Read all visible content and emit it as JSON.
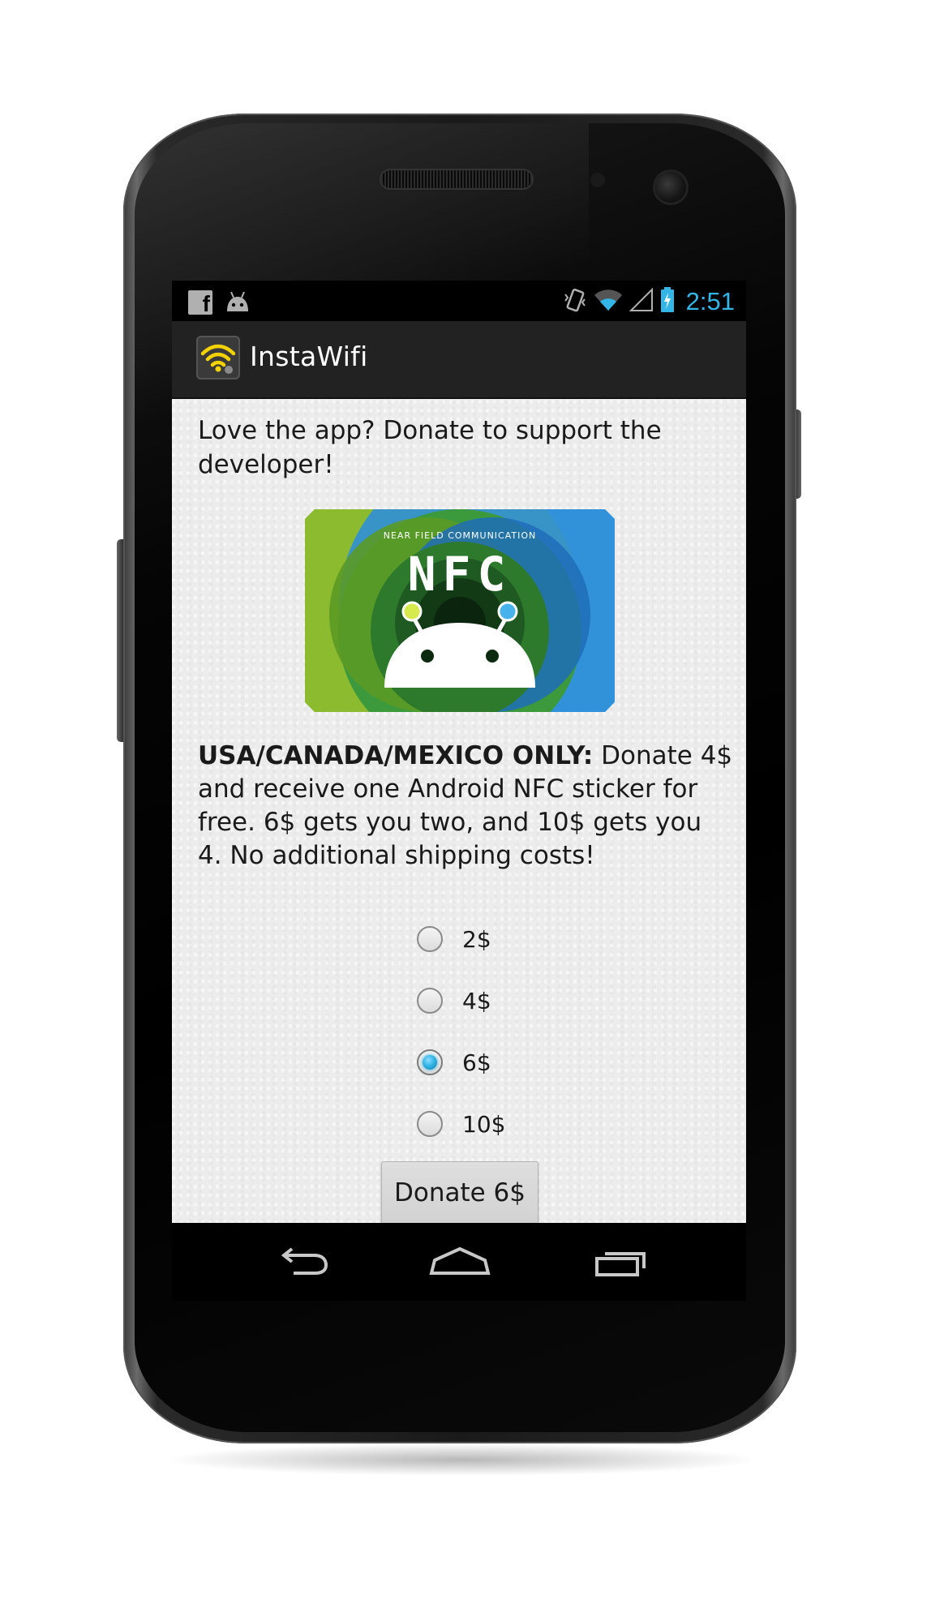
{
  "status_bar": {
    "notification_icons": [
      "facebook-icon",
      "android-icon"
    ],
    "system_icons": [
      "vibrate-icon",
      "wifi-icon",
      "signal-icon",
      "battery-charging-icon"
    ],
    "time": "2:51",
    "accent_color": "#33b5e5"
  },
  "action_bar": {
    "app_icon": "wifi-app-icon",
    "title": "InstaWifi"
  },
  "content": {
    "intro_text": "Love the app? Donate to support the developer!",
    "nfc_image": {
      "header_text": "NEAR FIELD COMMUNICATION",
      "logo_text": "NFC"
    },
    "promo_bold": "USA/CANADA/MEXICO ONLY:",
    "promo_text": " Donate 4$ and receive one Android NFC sticker for free. 6$ gets you two, and 10$ gets you 4. No additional shipping costs!",
    "donation_options": [
      {
        "label": "2$",
        "checked": false
      },
      {
        "label": "4$",
        "checked": false
      },
      {
        "label": "6$",
        "checked": true
      },
      {
        "label": "10$",
        "checked": false
      }
    ],
    "donate_button_label": "Donate 6$"
  },
  "nav_bar": {
    "buttons": [
      "back-icon",
      "home-icon",
      "recent-apps-icon"
    ]
  }
}
